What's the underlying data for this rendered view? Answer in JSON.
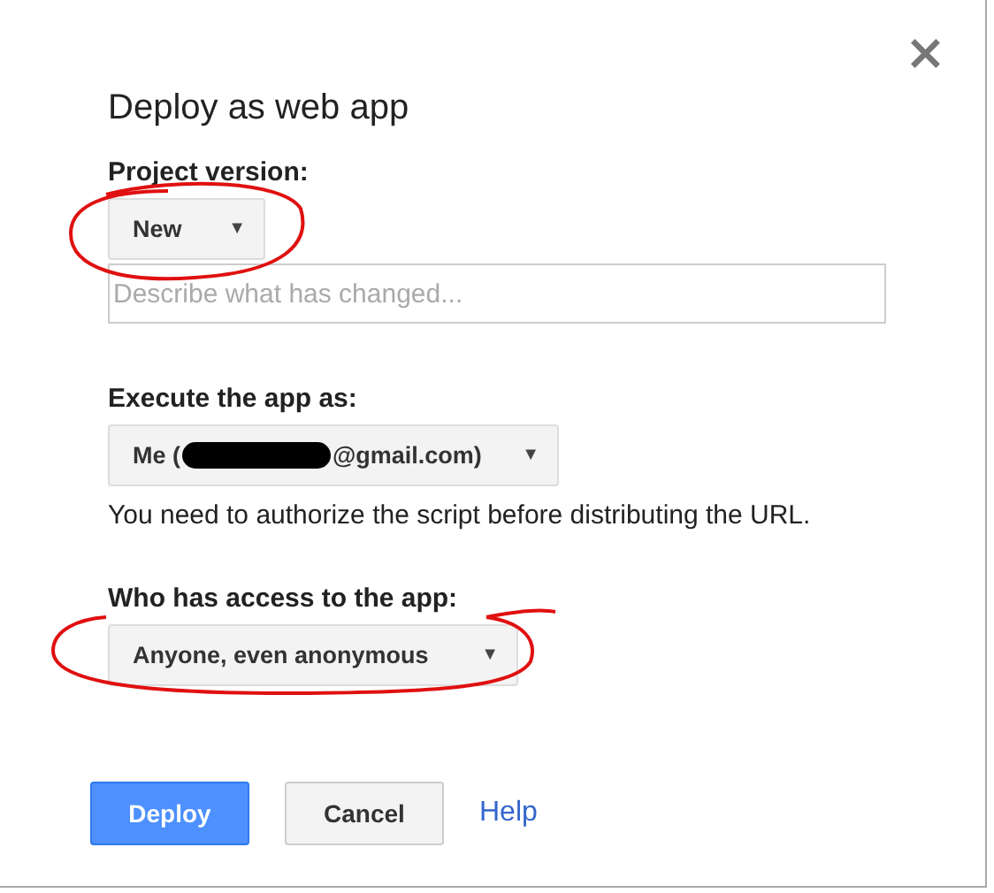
{
  "dialog": {
    "title": "Deploy as web app",
    "close": "×"
  },
  "project_version": {
    "label": "Project version:",
    "value": "New",
    "caret": "▼",
    "annotated": true,
    "description": {
      "placeholder": "Describe what has changed..."
    }
  },
  "execute_as": {
    "label": "Execute the app as:",
    "value_parts": [
      "Me (",
      "@gmail.com)"
    ],
    "redacted": true,
    "caret": "▼",
    "note": "You need to authorize the script before distributing the URL."
  },
  "access": {
    "label": "Who has access to the app:",
    "value": "Anyone, even anonymous",
    "caret": "▼",
    "annotated": true
  },
  "buttons": [
    {
      "label": "Deploy",
      "kind": "primary"
    },
    {
      "label": "Cancel",
      "kind": "secondary"
    },
    {
      "label": "Help",
      "kind": "link"
    }
  ]
}
